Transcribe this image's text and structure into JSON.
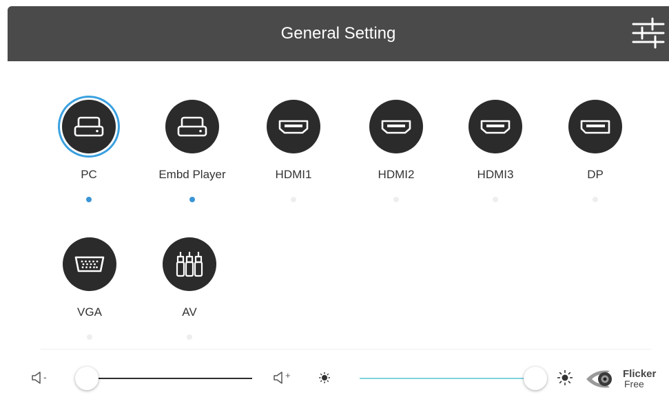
{
  "header": {
    "title": "General Setting",
    "settings_icon": "sliders-icon"
  },
  "sources": [
    {
      "label": "PC",
      "icon": "pc-icon",
      "selected": true,
      "active": true
    },
    {
      "label": "Embd Player",
      "icon": "embedded-player-icon",
      "selected": false,
      "active": true
    },
    {
      "label": "HDMI1",
      "icon": "hdmi-icon",
      "selected": false,
      "active": false
    },
    {
      "label": "HDMI2",
      "icon": "hdmi-icon",
      "selected": false,
      "active": false
    },
    {
      "label": "HDMI3",
      "icon": "hdmi-icon",
      "selected": false,
      "active": false
    },
    {
      "label": "DP",
      "icon": "displayport-icon",
      "selected": false,
      "active": false
    },
    {
      "label": "VGA",
      "icon": "vga-icon",
      "selected": false,
      "active": false
    },
    {
      "label": "AV",
      "icon": "av-icon",
      "selected": false,
      "active": false
    }
  ],
  "volume": {
    "minus_label": "-",
    "plus_label": "+",
    "level_fraction": 0.0
  },
  "brightness": {
    "level_fraction": 1.0
  },
  "flicker_free": {
    "line1": "Flicker",
    "line2": "Free"
  },
  "colors": {
    "header_bg": "#4a4a4a",
    "accent": "#3aa0df",
    "active_dot": "#3a95d6",
    "brightness_track": "#7fd1df",
    "icon_circle": "#2b2b2b"
  }
}
